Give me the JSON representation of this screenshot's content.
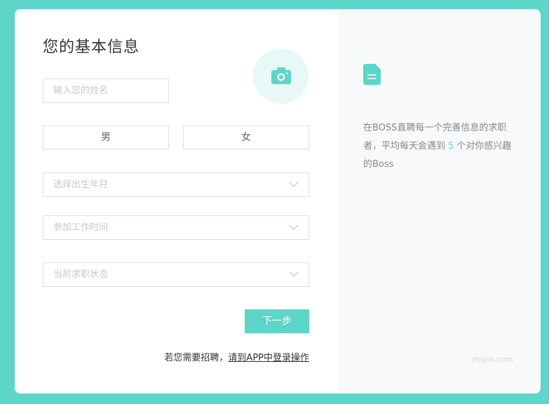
{
  "form": {
    "title": "您的基本信息",
    "name_placeholder": "输入您的姓名",
    "gender_male": "男",
    "gender_female": "女",
    "birth_placeholder": "选择出生年月",
    "work_start_placeholder": "参加工作时间",
    "job_status_placeholder": "当前求职状态",
    "next_label": "下一步",
    "recruit_prefix": "若您需要招聘，",
    "recruit_link": "请到APP中登录操作"
  },
  "side": {
    "tip_before": "在BOSS直聘每一个完善信息的求职者，平均每天会遇到",
    "tip_count": "5",
    "tip_after": "个对你感兴趣的Boss",
    "site": "zhipin.com"
  },
  "icons": {
    "avatar": "camera-icon",
    "dropdown": "chevron-down-icon",
    "tip": "document-icon"
  },
  "colors": {
    "accent": "#5dd5c8",
    "avatar_bg": "#e8f8f6",
    "right_panel_bg": "#f8f9fb"
  }
}
